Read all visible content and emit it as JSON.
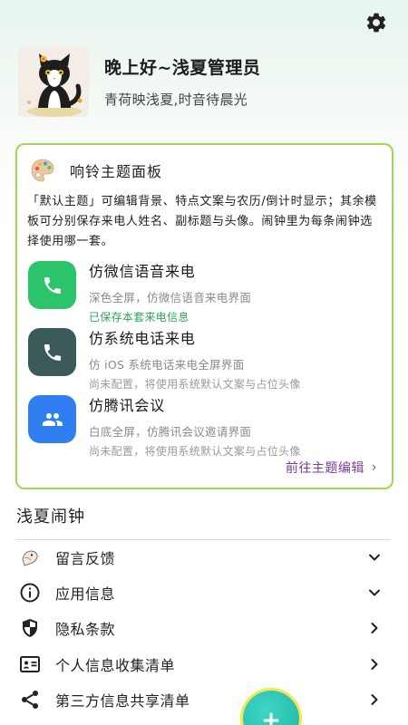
{
  "header": {
    "greeting": "晚上好~浅夏管理员",
    "motto": "青荷映浅夏,时音待晨光",
    "settings_icon": "gear-icon"
  },
  "theme_panel": {
    "title": "响铃主题面板",
    "description": "「默认主题」可编辑背景、特点文案与农历/倒计时显示；其余模板可分别保存来电人姓名、副标题与头像。闹钟里为每条闹钟选择使用哪一套。",
    "entries": [
      {
        "title": "仿微信语音来电",
        "subtitle": "深色全屏，仿微信语音来电界面",
        "status": "已保存本套来电信息",
        "icon": "phone-icon",
        "color": "#2bc46a",
        "status_color": "#2ea45a"
      },
      {
        "title": "仿系统电话来电",
        "subtitle": "仿 iOS 系统电话来电全屏界面",
        "status": "尚未配置，将使用系统默认文案与占位头像",
        "icon": "phone-icon",
        "color": "#3d5a5a",
        "status_color": "#9a9a9a"
      },
      {
        "title": "仿腾讯会议",
        "subtitle": "白底全屏，仿腾讯会议邀请界面",
        "status": "尚未配置，将使用系统默认文案与占位头像",
        "icon": "people-icon",
        "color": "#2f7ff0",
        "status_color": "#9a9a9a"
      }
    ],
    "goto_label": "前往主题编辑",
    "goto_chevron": "›",
    "accent_color": "#a9d25a",
    "link_color": "#7a3a9a"
  },
  "section": {
    "title": "浅夏闹钟"
  },
  "menu": [
    {
      "label": "留言反馈",
      "icon": "feedback-bird-icon",
      "arrow": "chevron-down"
    },
    {
      "label": "应用信息",
      "icon": "info-icon",
      "arrow": "chevron-down"
    },
    {
      "label": "隐私条款",
      "icon": "shield-icon",
      "arrow": "chevron-right"
    },
    {
      "label": "个人信息收集清单",
      "icon": "id-card-icon",
      "arrow": "chevron-right"
    },
    {
      "label": "第三方信息共享清单",
      "icon": "share-icon",
      "arrow": "chevron-right"
    }
  ],
  "fab": {
    "label": "+"
  }
}
